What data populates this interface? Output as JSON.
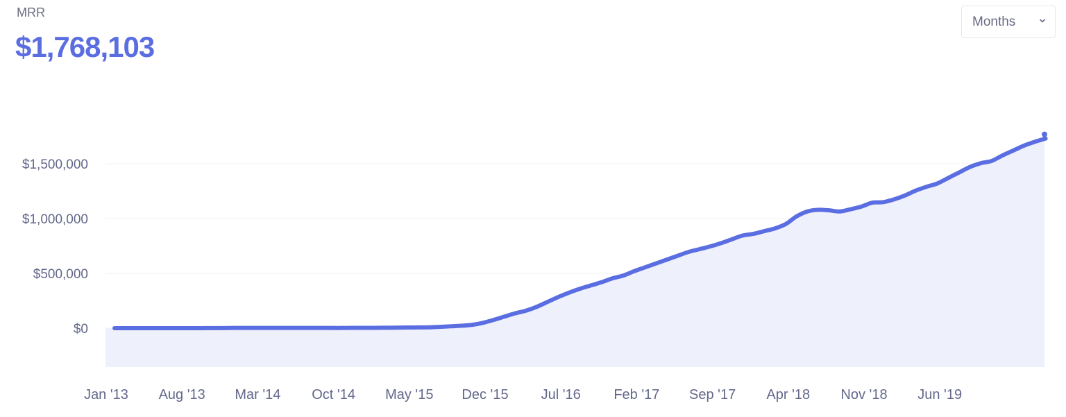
{
  "header": {
    "metric_label": "MRR",
    "metric_value": "$1,768,103"
  },
  "controls": {
    "period_select": {
      "selected": "Months",
      "icon": "chevron-down-icon"
    }
  },
  "colors": {
    "accent": "#5b6ee1",
    "area_fill": "#eef0fc",
    "gridline": "#f1f2f6",
    "tick_text": "#63678a"
  },
  "chart_data": {
    "type": "area",
    "title": "MRR",
    "xlabel": "",
    "ylabel": "",
    "ylim": [
      -350000,
      1800000
    ],
    "grid": true,
    "legend": "none",
    "y_ticks": [
      {
        "value": 0,
        "label": "$0"
      },
      {
        "value": 500000,
        "label": "$500,000"
      },
      {
        "value": 1000000,
        "label": "$1,000,000"
      },
      {
        "value": 1500000,
        "label": "$1,500,000"
      }
    ],
    "x_ticks": [
      {
        "index": 0,
        "label": "Jan '13"
      },
      {
        "index": 7,
        "label": "Aug '13"
      },
      {
        "index": 14,
        "label": "Mar '14"
      },
      {
        "index": 21,
        "label": "Oct '14"
      },
      {
        "index": 28,
        "label": "May '15"
      },
      {
        "index": 35,
        "label": "Dec '15"
      },
      {
        "index": 42,
        "label": "Jul '16"
      },
      {
        "index": 49,
        "label": "Feb '17"
      },
      {
        "index": 56,
        "label": "Sep '17"
      },
      {
        "index": 63,
        "label": "Apr '18"
      },
      {
        "index": 70,
        "label": "Nov '18"
      },
      {
        "index": 77,
        "label": "Jun '19"
      }
    ],
    "x_start": "Jan 2013",
    "x_interval": "month",
    "series": [
      {
        "name": "MRR",
        "values": [
          0,
          0,
          0,
          0,
          0,
          0,
          0,
          0,
          0,
          1000,
          1000,
          2000,
          2000,
          2000,
          2000,
          2000,
          2000,
          2000,
          2000,
          2000,
          2000,
          2000,
          3000,
          3000,
          3000,
          4000,
          5000,
          6000,
          7000,
          8000,
          12000,
          17000,
          22000,
          30000,
          48000,
          75000,
          105000,
          135000,
          160000,
          195000,
          240000,
          285000,
          325000,
          360000,
          390000,
          420000,
          455000,
          480000,
          520000,
          555000,
          590000,
          625000,
          660000,
          695000,
          720000,
          745000,
          775000,
          810000,
          845000,
          860000,
          885000,
          910000,
          950000,
          1020000,
          1065000,
          1080000,
          1075000,
          1065000,
          1085000,
          1110000,
          1145000,
          1150000,
          1175000,
          1210000,
          1255000,
          1290000,
          1320000,
          1370000,
          1420000,
          1470000,
          1505000,
          1525000,
          1575000,
          1620000,
          1665000,
          1700000,
          1730000,
          1768103
        ],
        "last_point_projected": true
      }
    ]
  }
}
